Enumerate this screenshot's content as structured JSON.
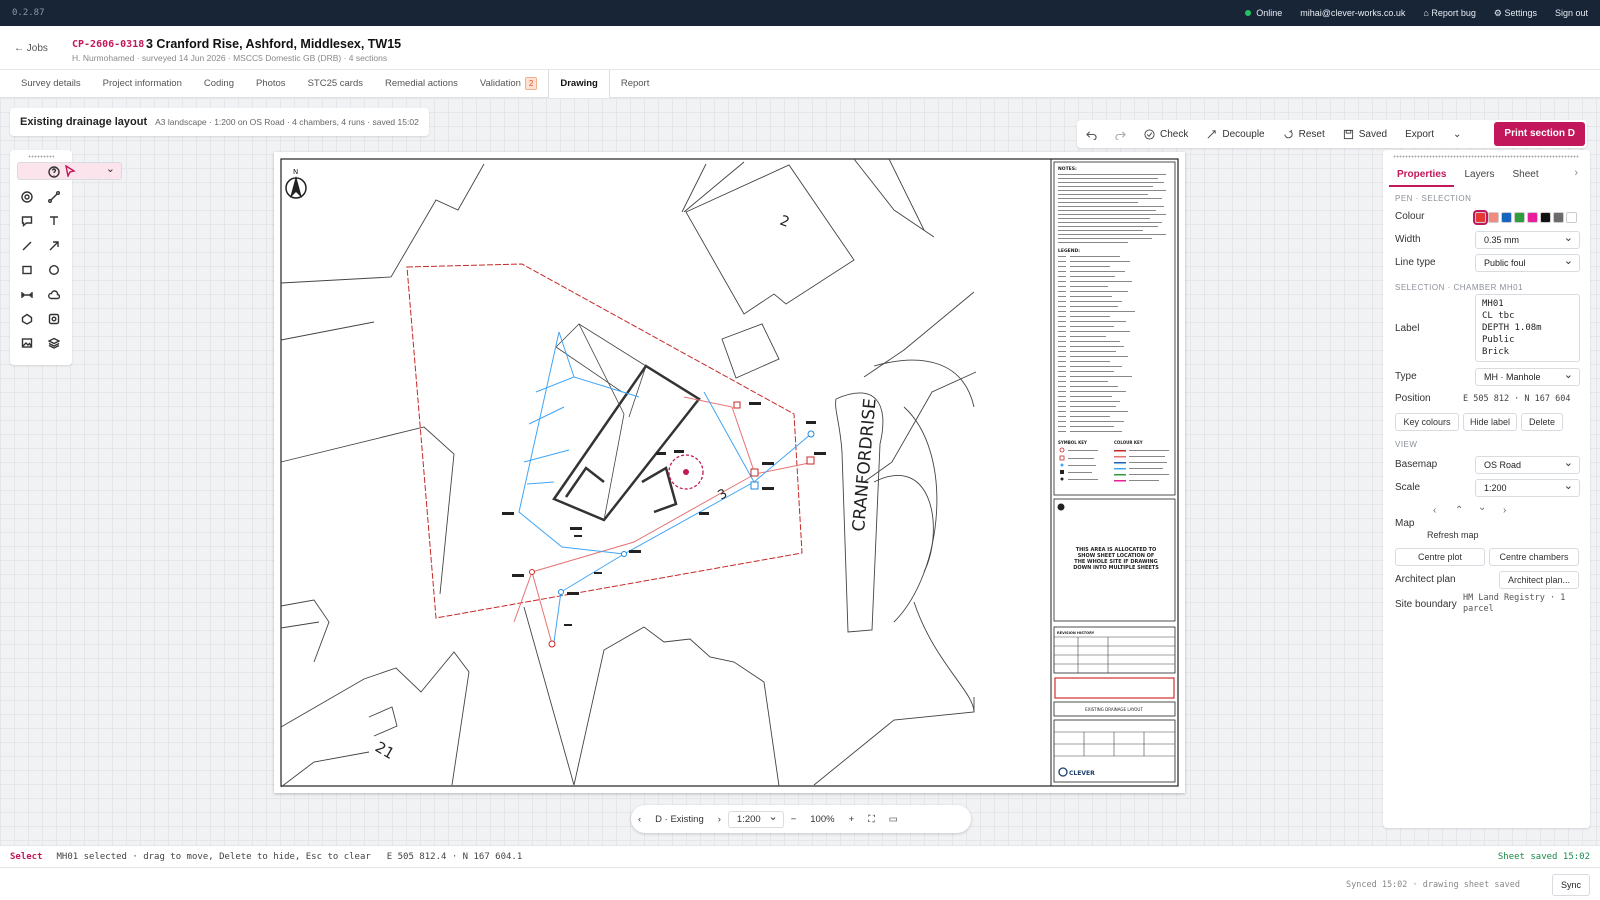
{
  "topbar": {
    "version": "0.2.87",
    "status": "Online",
    "user": "mihai@clever-works.co.uk",
    "report_bug": "Report bug",
    "settings": "Settings",
    "sign_out": "Sign out"
  },
  "job": {
    "back": "← Jobs",
    "id": "CP-2606-0318",
    "title": "3 Cranford Rise, Ashford, Middlesex, TW15",
    "subtitle": "H. Nurmohamed · surveyed 14 Jun 2026 · MSCC5 Domestic GB (DRB) · 4 sections"
  },
  "tabs": [
    "Survey details",
    "Project information",
    "Coding",
    "Photos",
    "STC25 cards",
    "Remedial actions",
    "Validation",
    "Drawing",
    "Report"
  ],
  "validation_badge": "2",
  "active_tab": "Drawing",
  "drawing_title": {
    "title": "Existing drainage layout",
    "meta": "A3 landscape · 1:200 on OS Road · 4 chambers, 4 runs · saved 15:02"
  },
  "toolbar": {
    "check": "Check",
    "decouple": "Decouple",
    "reset": "Reset",
    "saved": "Saved",
    "export": "Export",
    "print": "Print section D"
  },
  "map": {
    "street": "CRANFORDRISE",
    "house_2": "2",
    "house_3": "3",
    "house_21": "21",
    "north": "N"
  },
  "panel": {
    "tabs": [
      "Properties",
      "Layers",
      "Sheet"
    ],
    "pen_section": "PEN · SELECTION",
    "colour_label": "Colour",
    "colours": [
      "#e53935",
      "#f28b82",
      "#1565c0",
      "#2e9d3c",
      "#e91e9c",
      "#111111",
      "#6b6b6b",
      "#ffffff"
    ],
    "width_label": "Width",
    "width": "0.35 mm",
    "linetype_label": "Line type",
    "linetype": "Public foul",
    "selection_section": "SELECTION · CHAMBER MH01",
    "label_label": "Label",
    "label_value": "MH01\nCL tbc\nDEPTH 1.08m\nPublic\nBrick",
    "type_label": "Type",
    "type": "MH · Manhole",
    "position_label": "Position",
    "position": "E 505 812 · N 167 604",
    "key_colours": "Key colours",
    "hide_label": "Hide label",
    "delete": "Delete",
    "view_section": "VIEW",
    "basemap_label": "Basemap",
    "basemap": "OS Road",
    "scale_label": "Scale",
    "scale": "1:200",
    "map_label": "Map",
    "refresh_map": "Refresh map",
    "centre_plot": "Centre plot",
    "centre_chambers": "Centre chambers",
    "architect_label": "Architect plan",
    "architect_btn": "Architect plan...",
    "site_boundary_label": "Site boundary",
    "site_boundary": "HM Land Registry · 1 parcel"
  },
  "bottom_nav": {
    "sheet": "D · Existing",
    "scale": "1:200",
    "zoom": "100%"
  },
  "status": {
    "mode": "Select",
    "message": "MH01 selected · drag to move, Delete to hide, Esc to clear",
    "coords": "E 505 812.4 · N 167 604.1",
    "saved": "Sheet saved 15:02"
  },
  "footer": {
    "synced": "Synced 15:02 · drawing sheet saved",
    "sync": "Sync"
  },
  "sheet_text": {
    "notes": "NOTES:",
    "legend": "LEGEND:",
    "symbol_key": "SYMBOL KEY",
    "colour_key": "COLOUR KEY",
    "location_note": "THIS AREA IS ALLOCATED TO SHOW SHEET LOCATION OF THE WHOLE SITE IF DRAWING DOWN INTO MULTIPLE SHEETS",
    "revision_history": "REVISION HISTORY",
    "sheet_title": "EXISTING DRAINAGE LAYOUT",
    "brand": "CLEVER"
  }
}
